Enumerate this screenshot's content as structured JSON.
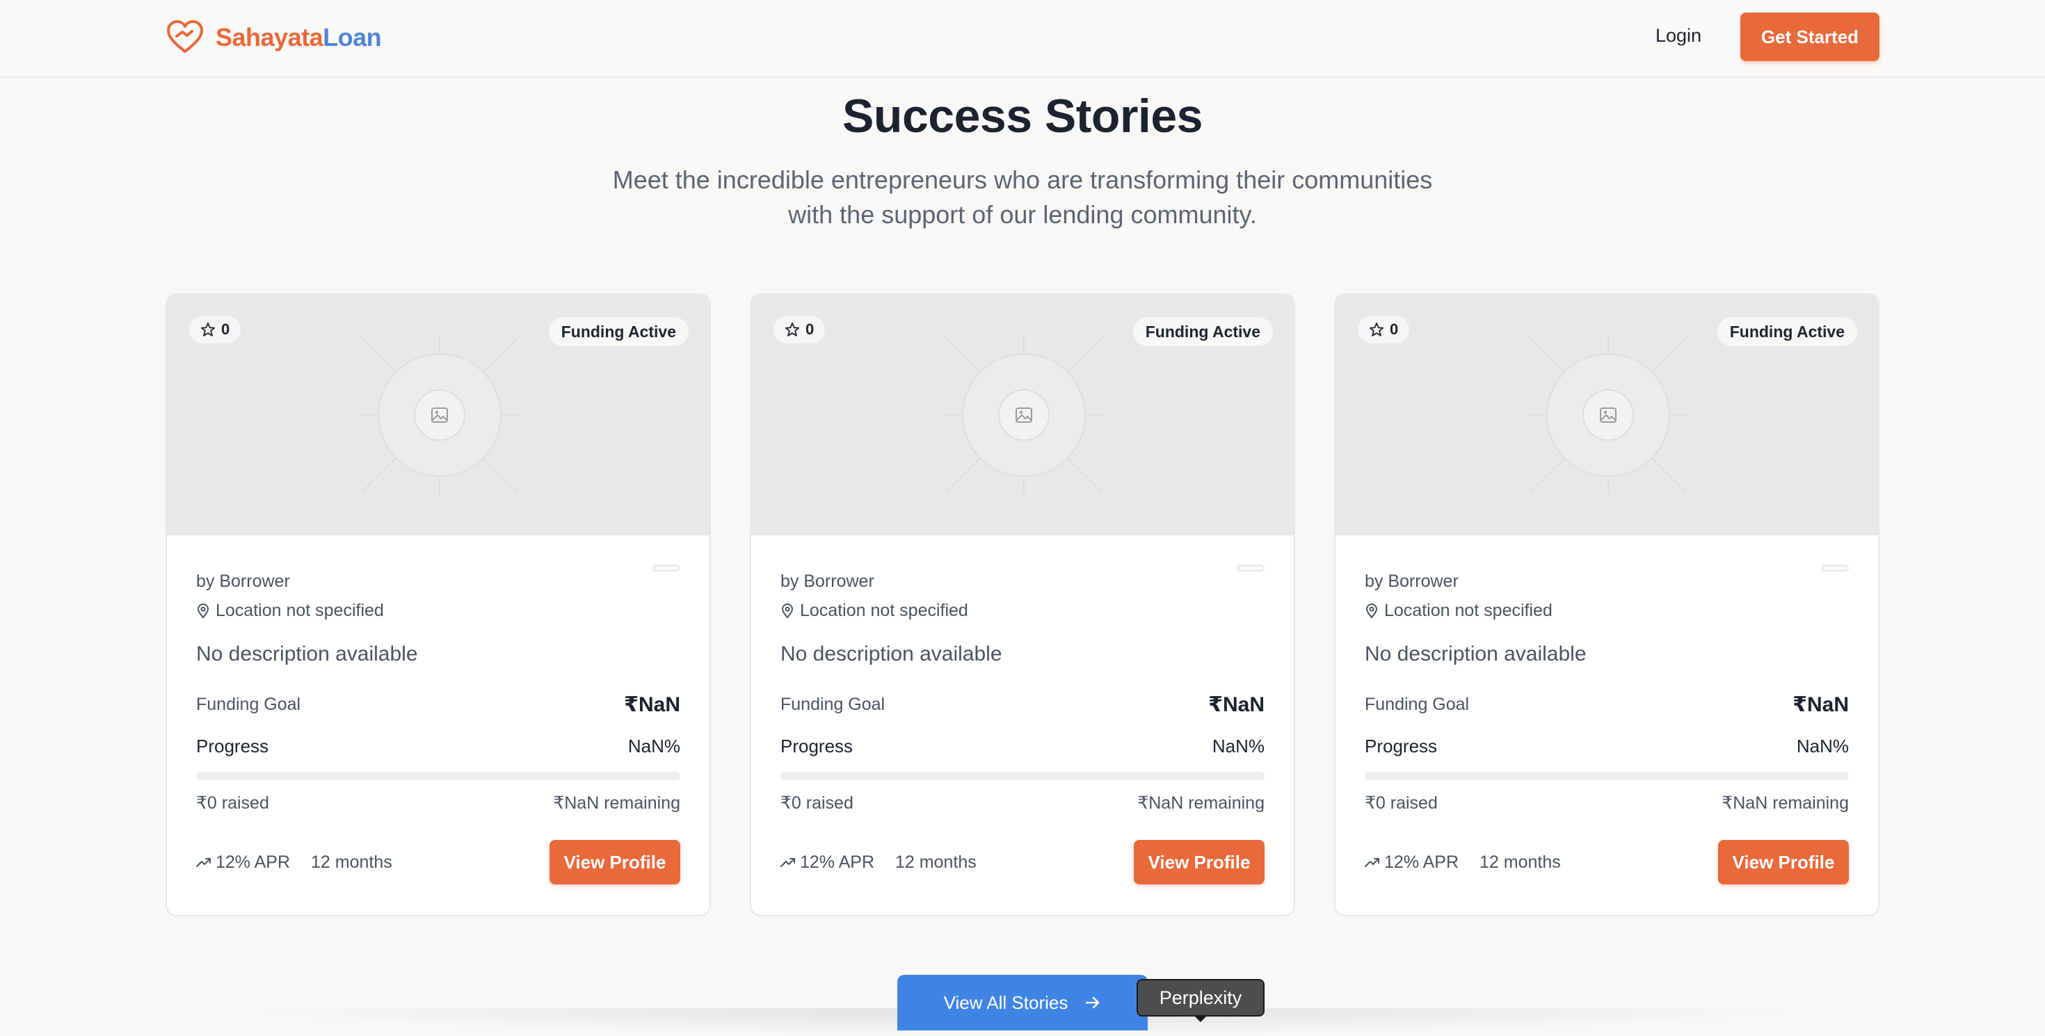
{
  "header": {
    "brand_part1": "Sahayata",
    "brand_part2": "Loan",
    "login": "Login",
    "get_started": "Get Started"
  },
  "hero": {
    "title": "Success Stories",
    "subtitle": "Meet the incredible entrepreneurs who are transforming their communities with the support of our lending community."
  },
  "cards": [
    {
      "stars": "0",
      "status": "Funding Active",
      "by": "by Borrower",
      "location": "Location not specified",
      "description": "No description available",
      "goal_label": "Funding Goal",
      "goal_value": "₹NaN",
      "progress_label": "Progress",
      "progress_value": "NaN%",
      "progress_fraction": 0,
      "raised": "₹0 raised",
      "remaining": "₹NaN remaining",
      "apr": "12% APR",
      "term": "12 months",
      "cta": "View Profile"
    },
    {
      "stars": "0",
      "status": "Funding Active",
      "by": "by Borrower",
      "location": "Location not specified",
      "description": "No description available",
      "goal_label": "Funding Goal",
      "goal_value": "₹NaN",
      "progress_label": "Progress",
      "progress_value": "NaN%",
      "progress_fraction": 0,
      "raised": "₹0 raised",
      "remaining": "₹NaN remaining",
      "apr": "12% APR",
      "term": "12 months",
      "cta": "View Profile"
    },
    {
      "stars": "0",
      "status": "Funding Active",
      "by": "by Borrower",
      "location": "Location not specified",
      "description": "No description available",
      "goal_label": "Funding Goal",
      "goal_value": "₹NaN",
      "progress_label": "Progress",
      "progress_value": "NaN%",
      "progress_fraction": 0,
      "raised": "₹0 raised",
      "remaining": "₹NaN remaining",
      "apr": "12% APR",
      "term": "12 months",
      "cta": "View Profile"
    }
  ],
  "footer": {
    "view_all": "View All Stories",
    "tooltip": "Perplexity"
  },
  "icons": {
    "logo": "heart-hands-icon",
    "star": "star-icon",
    "image_placeholder": "image-icon",
    "location": "map-pin-icon",
    "trend": "trending-up-icon",
    "arrow": "arrow-right-icon"
  },
  "colors": {
    "accent": "#e8693a",
    "brand_blue": "#4f84d8",
    "cta_blue": "#3f84e5"
  }
}
